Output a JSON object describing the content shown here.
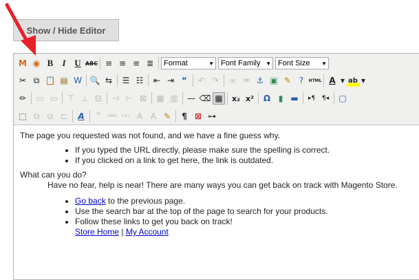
{
  "show_hide_button": {
    "label": "Show / Hide Editor"
  },
  "toolbar": {
    "format_select": {
      "value": "Format"
    },
    "font_family_select": {
      "value": "Font Family"
    },
    "font_size_select": {
      "value": "Font Size"
    },
    "bold": "B",
    "italic": "I",
    "underline": "U",
    "strikethrough": "ABC",
    "html_label": "HTML",
    "superscript": "x²",
    "subscript": "x₂",
    "omega": "Ω",
    "paragraph": "¶"
  },
  "content": {
    "intro": "The page you requested was not found, and we have a fine guess why.",
    "bullets1": [
      "If you typed the URL directly, please make sure the spelling is correct.",
      "If you clicked on a link to get here, the link is outdated."
    ],
    "question": "What can you do?",
    "help_text": "Have no fear, help is near! There are many ways you can get back on track with Magento Store.",
    "bullet_goback_link": "Go back",
    "bullet_goback_rest": " to the previous page.",
    "bullet_search": "Use the search bar at the top of the page to search for your products.",
    "bullet_follow": "Follow these links to get you back on track!",
    "store_home_link": "Store Home",
    "separator": " | ",
    "my_account_link": "My Account"
  },
  "colors": {
    "arrow": "#e8202a",
    "link": "#0000cc"
  }
}
